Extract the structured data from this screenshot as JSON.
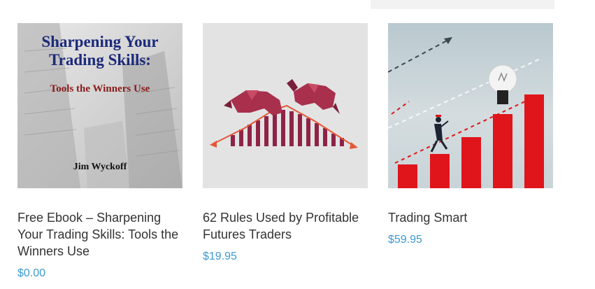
{
  "products": [
    {
      "cover": {
        "title_line1": "Sharpening Your",
        "title_line2": "Trading Skills:",
        "subtitle": "Tools the Winners Use",
        "author": "Jim Wyckoff"
      },
      "title": "Free Ebook – Sharpening Your Trading Skills: Tools the Winners Use",
      "price": "$0.00"
    },
    {
      "title": "62 Rules Used by Profitable Futures Traders",
      "price": "$19.95"
    },
    {
      "title": "Trading Smart",
      "price": "$59.95"
    }
  ],
  "colors": {
    "title_text": "#333333",
    "price_text": "#3d9ad1",
    "bar_red": "#e0151b",
    "bar_maroon": "#8e2346"
  }
}
